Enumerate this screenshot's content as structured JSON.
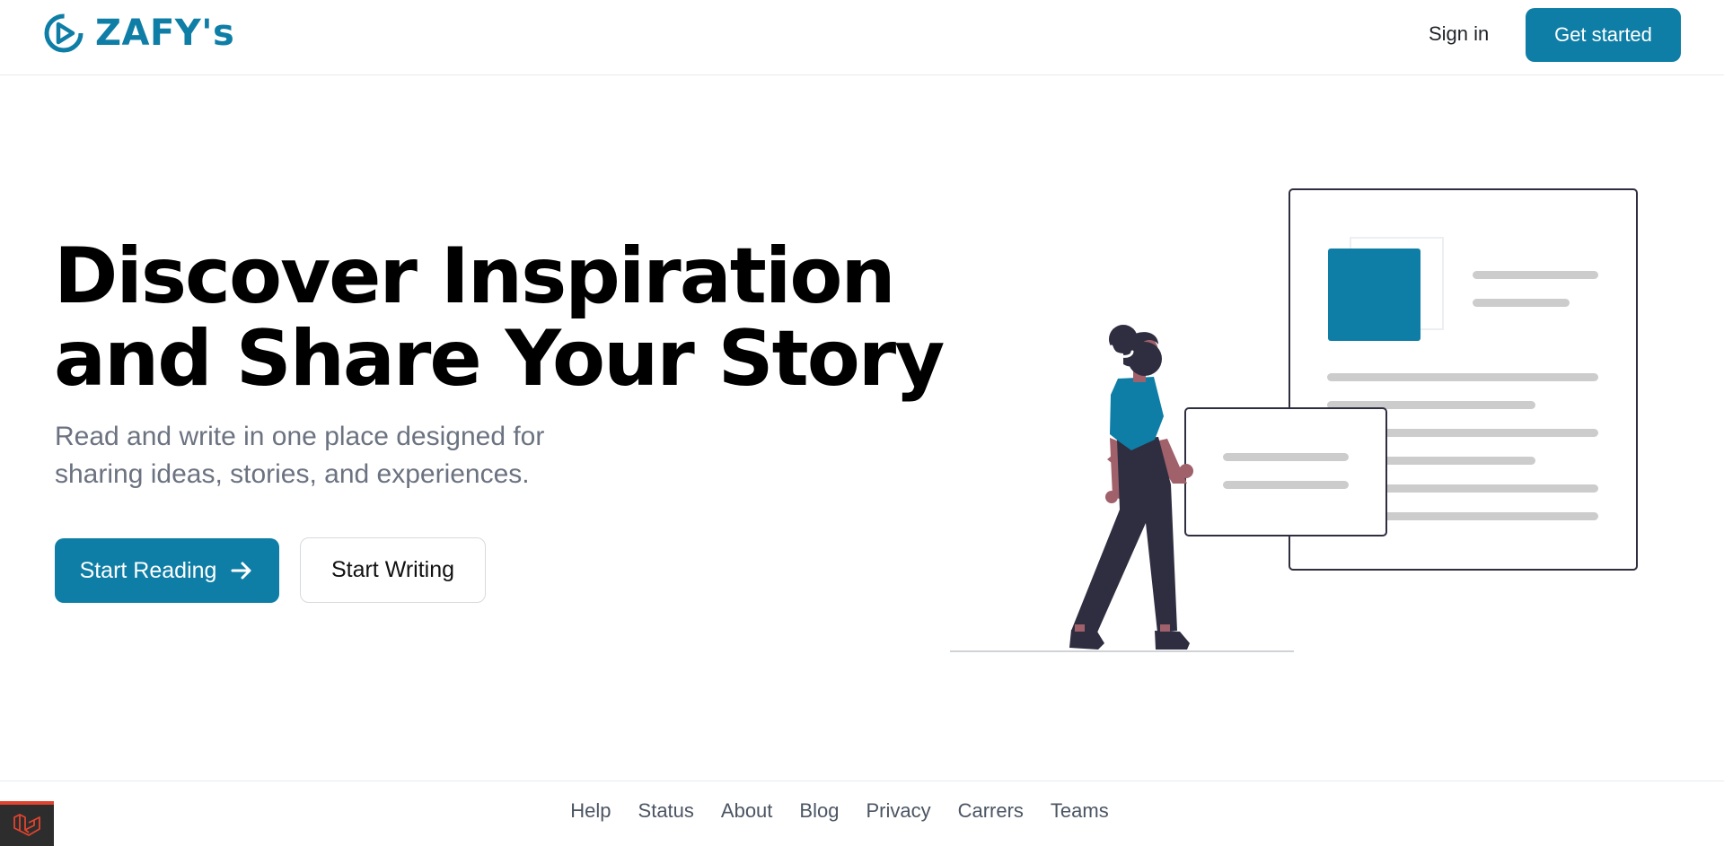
{
  "header": {
    "brand_name": "ZAFY's",
    "logo_icon": "zafy-logo-icon",
    "sign_in_label": "Sign in",
    "get_started_label": "Get started"
  },
  "hero": {
    "title_line1": "Discover Inspiration",
    "title_line2": "and Share Your Story",
    "subtitle_line1": "Read and write in one place designed for",
    "subtitle_line2": "sharing ideas, stories, and experiences.",
    "start_reading_label": "Start Reading",
    "start_reading_icon": "arrow-right-icon",
    "start_writing_label": "Start Writing",
    "illustration": "woman-reading-document-illustration"
  },
  "footer": {
    "links": [
      "Help",
      "Status",
      "About",
      "Blog",
      "Privacy",
      "Carrers",
      "Teams"
    ]
  },
  "debug_badge": {
    "icon": "laravel-icon"
  },
  "colors": {
    "accent": "#0e7ea6",
    "heading": "#000000",
    "subtext": "#6b7280",
    "illustration_dark": "#2f2e41",
    "illustration_skin": "#a0616a",
    "line_gray": "#cccccc"
  }
}
